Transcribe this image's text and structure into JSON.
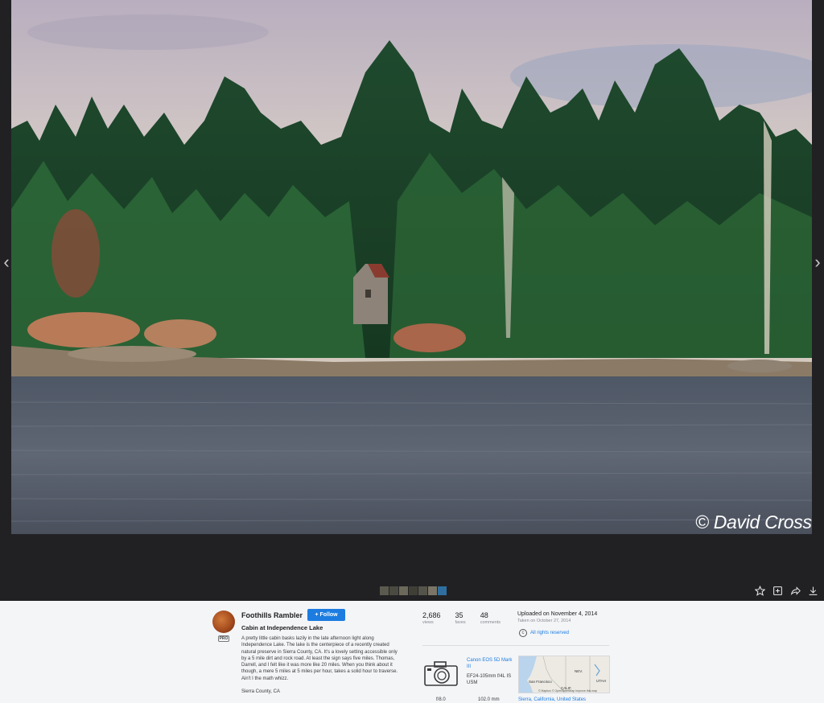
{
  "viewer": {
    "photo_alt": "Cabin at Independence Lake",
    "watermark": "© David Cross",
    "prev_icon": "chevron-left-icon",
    "next_icon": "chevron-right-icon",
    "thumbnails": [
      "#5b5a4e",
      "#4a4a40",
      "#6b6a5a",
      "#3f3f36",
      "#55544a",
      "#7a7566",
      "#2f6f9f"
    ],
    "actions": [
      {
        "name": "fave-star-icon"
      },
      {
        "name": "add-to-gallery-icon"
      },
      {
        "name": "share-icon"
      },
      {
        "name": "download-icon"
      }
    ]
  },
  "owner": {
    "name": "Foothills Rambler",
    "pro": "PRO",
    "follow": "Follow"
  },
  "photo": {
    "title": "Cabin at Independence Lake",
    "description": "A pretty little cabin basks lazily in the late afternoon light along Independence Lake. The lake is the centerpiece of a recently created natural preserve in Sierra County, CA. It's a lovely setting accessible only by a 5 mile dirt and rock road. At least the sign says five miles. Thomas, Darrell, and I felt like it was more like 20 miles. When you think about it though, a mere 5 miles at 5 miles per hour, takes a solid hour to traverse. Ain't I the math whizz.",
    "location": "Sierra County, CA"
  },
  "stats": [
    {
      "value": "2,686",
      "label": "views"
    },
    {
      "value": "35",
      "label": "faves"
    },
    {
      "value": "48",
      "label": "comments"
    }
  ],
  "meta": {
    "uploaded": "Uploaded on November 4, 2014",
    "taken": "Taken on October 27, 2014",
    "rights": "All rights reserved"
  },
  "exif": {
    "camera": "Canon EOS 5D Mark III",
    "lens": "EF24-105mm f/4L IS USM",
    "aperture": "f/8.0",
    "focal": "102.0 mm"
  },
  "map": {
    "labels": [
      "NEV.",
      "UTAH",
      "San Francisco",
      "CALIF."
    ],
    "attribution": "© Mapbox © OpenStreetMap  Improve this map",
    "location_link": "Sierra, California, United States"
  },
  "colors": {
    "accent": "#1c7ce0",
    "viewer_bg": "#212124",
    "panel_bg": "#f4f5f7"
  }
}
